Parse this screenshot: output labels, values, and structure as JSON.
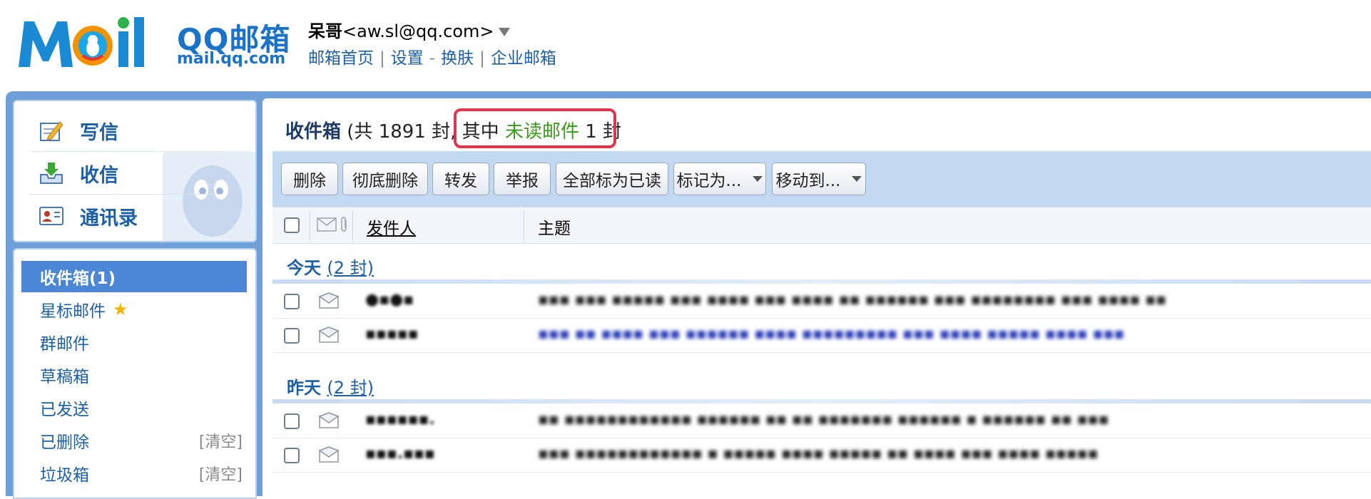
{
  "header": {
    "logo_cn": "QQ邮箱",
    "logo_url": "mail.qq.com",
    "user_name": "呆哥",
    "user_email": "<aw.sl@qq.com>",
    "links": [
      "邮箱首页",
      "设置",
      "换肤",
      "企业邮箱"
    ]
  },
  "quick": {
    "compose": "写信",
    "receive": "收信",
    "contacts": "通讯录"
  },
  "folders": [
    {
      "label": "收件箱(1)"
    },
    {
      "label": "星标邮件"
    },
    {
      "label": "群邮件"
    },
    {
      "label": "草稿箱"
    },
    {
      "label": "已发送"
    },
    {
      "label": "已删除",
      "action": "[清空]"
    },
    {
      "label": "垃圾箱",
      "action": "[清空]"
    }
  ],
  "inbox": {
    "name": "收件箱",
    "total_prefix": "(共",
    "total": "1891",
    "total_suffix": "封,",
    "unread_prefix": "其中",
    "unread_label": "未读邮件",
    "unread_count": "1",
    "unread_suffix": "封"
  },
  "toolbar": {
    "delete": "删除",
    "delete_forever": "彻底删除",
    "forward": "转发",
    "report": "举报",
    "mark_all_read": "全部标为已读",
    "mark_as": "标记为...",
    "move_to": "移动到..."
  },
  "columns": {
    "sender": "发件人",
    "subject": "主题"
  },
  "groups": [
    {
      "title": "今天",
      "count": "(2 封)",
      "rows": [
        {
          "sender": "●▪●▪",
          "subject": "▪▪▪ ▪▪▪ ▪▪▪▪▪ ▪▪▪ ▪▪▪▪ ▪▪▪ ▪▪▪▪ ▪▪ ▪▪▪▪▪▪ ▪▪▪ ▪▪▪▪▪▪▪▪ ▪▪▪ ▪▪▪▪ ▪▪"
        },
        {
          "sender": "▪▪▪▪▪",
          "subject": "▪▪▪ ▪▪ ▪▪▪▪ ▪▪▪ ▪▪▪▪▪▪ ▪▪▪▪ ▪▪▪▪▪▪▪▪▪ ▪▪▪ ▪▪▪▪ ▪▪▪▪▪ ▪▪▪▪ ▪▪▪"
        }
      ]
    },
    {
      "title": "昨天",
      "count": "(2 封)",
      "rows": [
        {
          "sender": "▪▪▪▪▪▪.",
          "subject": "▪▪ ▪▪▪▪▪▪▪▪▪▪▪▪ ▪▪▪▪▪▪ ▪▪ ▪▪ ▪▪▪▪▪▪▪ ▪▪▪▪▪▪ ▪ ▪▪▪▪▪▪ ▪▪ ▪▪▪"
        },
        {
          "sender": "▪▪▪.▪▪▪",
          "subject": "▪▪▪ ▪▪▪▪▪▪▪▪▪▪▪▪ ▪ ▪▪▪▪▪ ▪▪▪▪ ▪▪▪▪▪ ▪▪ ▪▪▪▪ ▪▪▪ ▪▪▪▪ ▪▪▪▪▪"
        }
      ]
    }
  ]
}
